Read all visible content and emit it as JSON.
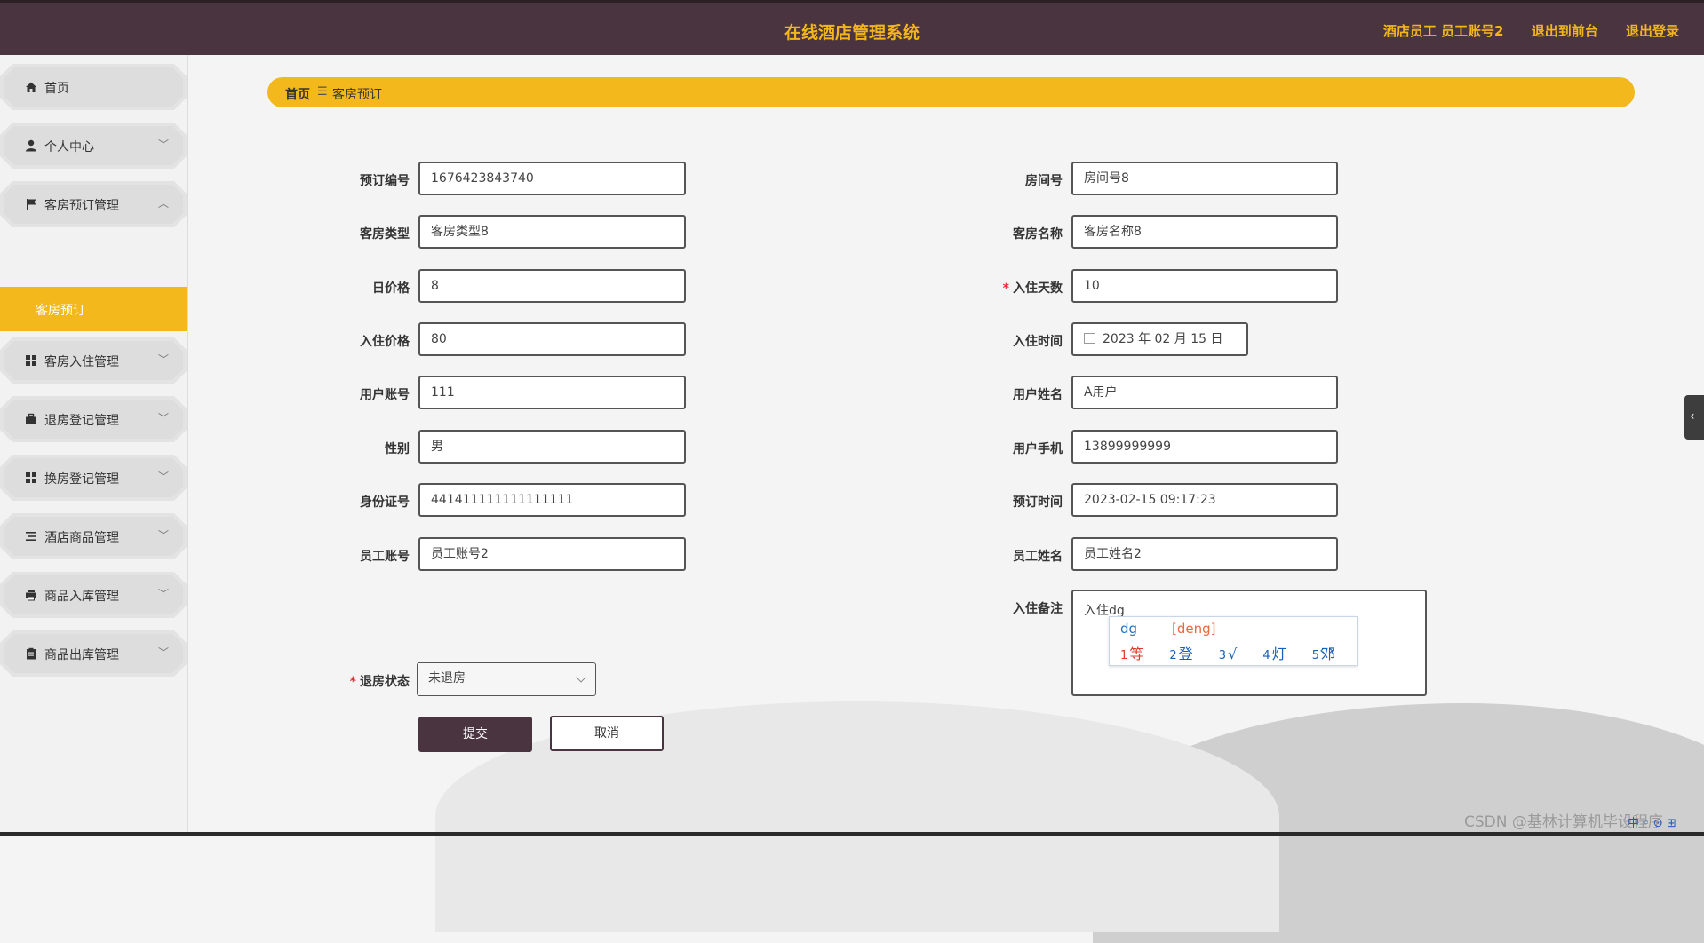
{
  "header": {
    "title": "在线酒店管理系统",
    "user": "酒店员工 员工账号2",
    "to_front": "退出到前台",
    "logout": "退出登录"
  },
  "sidebar": {
    "items": [
      {
        "label": "首页",
        "icon": "home-icon"
      },
      {
        "label": "个人中心",
        "icon": "user-icon",
        "chevron": "﹀"
      },
      {
        "label": "客房预订管理",
        "icon": "flag-icon",
        "chevron": "︿"
      },
      {
        "label": "客房入住管理",
        "icon": "grid-icon",
        "chevron": "﹀"
      },
      {
        "label": "退房登记管理",
        "icon": "briefcase-icon",
        "chevron": "﹀"
      },
      {
        "label": "换房登记管理",
        "icon": "grid-icon",
        "chevron": "﹀"
      },
      {
        "label": "酒店商品管理",
        "icon": "list-icon",
        "chevron": "﹀"
      },
      {
        "label": "商品入库管理",
        "icon": "printer-icon",
        "chevron": "﹀"
      },
      {
        "label": "商品出库管理",
        "icon": "clipboard-icon",
        "chevron": "﹀"
      }
    ],
    "active_sub": "客房预订"
  },
  "breadcrumb": {
    "home": "首页",
    "sep": "☰",
    "current": "客房预订"
  },
  "form": {
    "left": [
      {
        "label": "预订编号",
        "value": "1676423843740"
      },
      {
        "label": "客房类型",
        "value": "客房类型8"
      },
      {
        "label": "日价格",
        "value": "8"
      },
      {
        "label": "入住价格",
        "value": "80"
      },
      {
        "label": "用户账号",
        "value": "111"
      },
      {
        "label": "性别",
        "value": "男"
      },
      {
        "label": "身份证号",
        "value": "441411111111111111"
      },
      {
        "label": "员工账号",
        "value": "员工账号2"
      }
    ],
    "right": [
      {
        "label": "房间号",
        "value": "房间号8"
      },
      {
        "label": "客房名称",
        "value": "客房名称8"
      },
      {
        "label": "入住天数",
        "value": "10",
        "required": "*"
      },
      {
        "label": "入住时间",
        "value": "2023 年 02 月 15 日"
      },
      {
        "label": "用户姓名",
        "value": "A用户"
      },
      {
        "label": "用户手机",
        "value": "13899999999"
      },
      {
        "label": "预订时间",
        "value": "2023-02-15 09:17:23"
      },
      {
        "label": "员工姓名",
        "value": "员工姓名2"
      }
    ],
    "remark_label": "入住备注",
    "remark_value": "入住dg",
    "checkout_label": "退房状态",
    "checkout_required": "*",
    "checkout_value": "未退房",
    "submit": "提交",
    "cancel": "取消"
  },
  "ime": {
    "pinyin": "dg",
    "hint": "[deng]",
    "candidates": [
      {
        "n": "1",
        "c": "等"
      },
      {
        "n": "2",
        "c": "登"
      },
      {
        "n": "3",
        "c": "√"
      },
      {
        "n": "4",
        "c": "灯"
      },
      {
        "n": "5",
        "c": "邓"
      }
    ],
    "nav": "‹ ›"
  },
  "sidetab": "‹",
  "watermark": "CSDN @基林计算机毕设程序",
  "tray": "中 ◦ ⊙ ⊞"
}
